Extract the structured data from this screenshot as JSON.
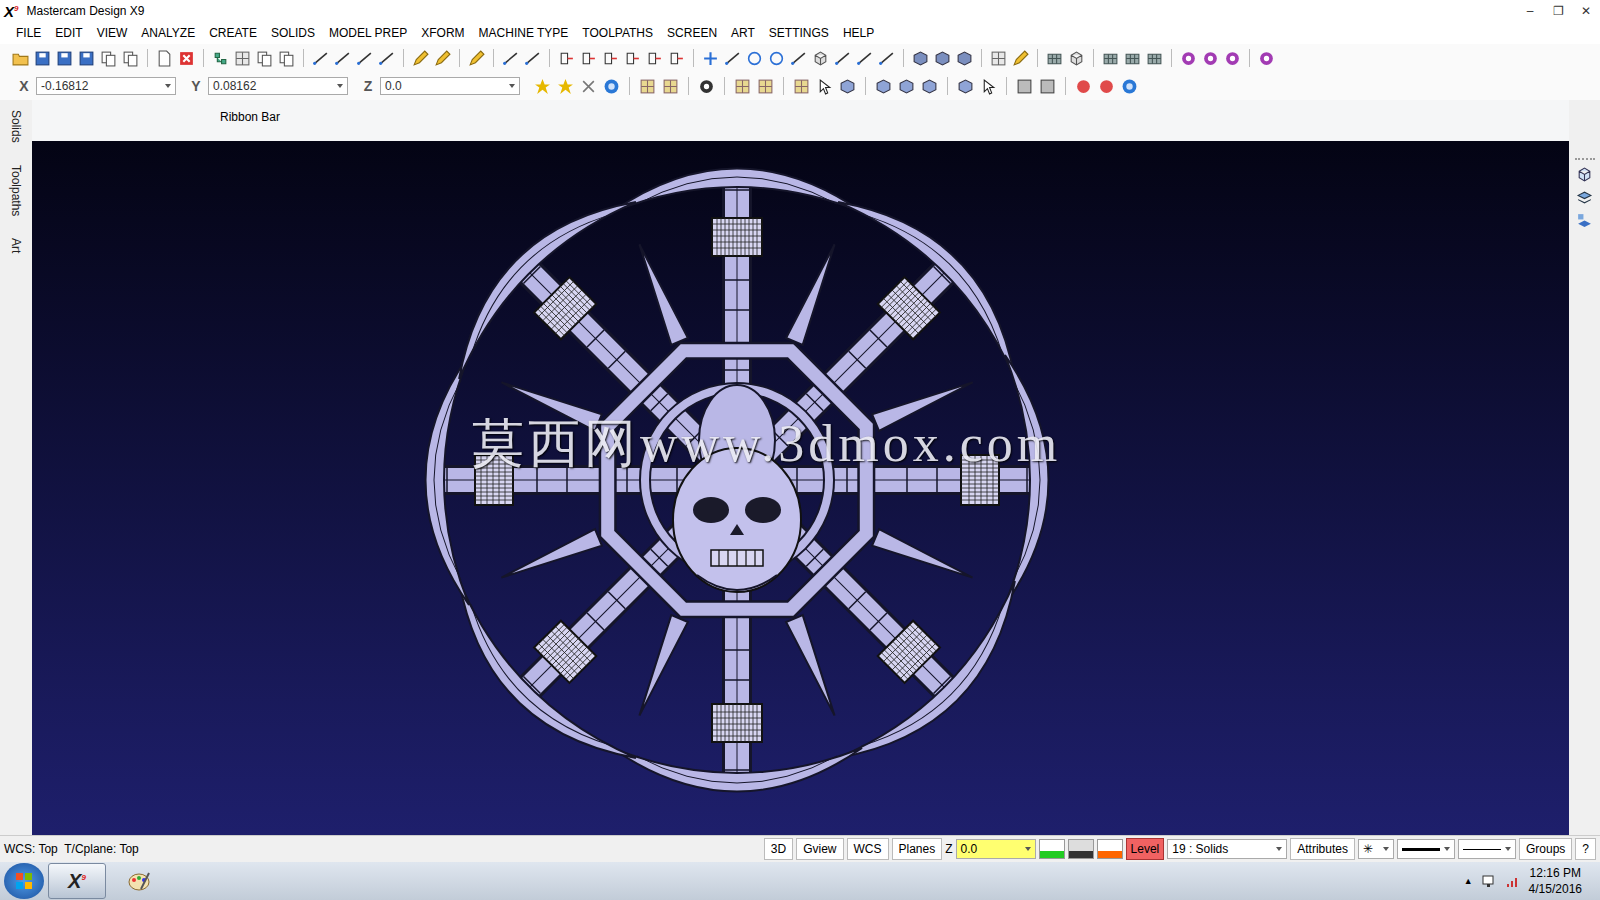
{
  "window": {
    "title": "Mastercam Design X9",
    "logo": {
      "letter": "X",
      "version": "9"
    },
    "controls": [
      "–",
      "❐",
      "✕"
    ]
  },
  "menu": [
    "FILE",
    "EDIT",
    "VIEW",
    "ANALYZE",
    "CREATE",
    "SOLIDS",
    "MODEL PREP",
    "XFORM",
    "MACHINE TYPE",
    "TOOLPATHS",
    "SCREEN",
    "ART",
    "SETTINGS",
    "HELP"
  ],
  "coordinates": [
    {
      "axis": "X",
      "value": "-0.16812"
    },
    {
      "axis": "Y",
      "value": "0.08162"
    },
    {
      "axis": "Z",
      "value": "0.0"
    }
  ],
  "ribbon_bar": {
    "label": "Ribbon Bar"
  },
  "side_tabs": [
    {
      "label": "Solids",
      "selected": false
    },
    {
      "label": "Toolpaths",
      "selected": false
    },
    {
      "label": "Art",
      "selected": false
    }
  ],
  "viewport": {
    "watermark": "莫西网www.3dmox.com"
  },
  "status_bar": {
    "planes": "WCS: Top  T/Cplane: Top",
    "buttons": [
      "3D",
      "Gview",
      "WCS",
      "Planes"
    ],
    "z_label": "Z",
    "z_value": "0.0",
    "level_label": "Level",
    "level_value": "19 : Solids",
    "attributes": "Attributes",
    "point_style": "✳",
    "groups": "Groups",
    "help": "?"
  },
  "taskbar": {
    "apps": [
      {
        "kind": "mastercam",
        "selected": true
      },
      {
        "kind": "paint",
        "selected": false
      }
    ],
    "tray_arrow": "▲",
    "time": "12:16 PM",
    "date": "4/15/2016"
  }
}
